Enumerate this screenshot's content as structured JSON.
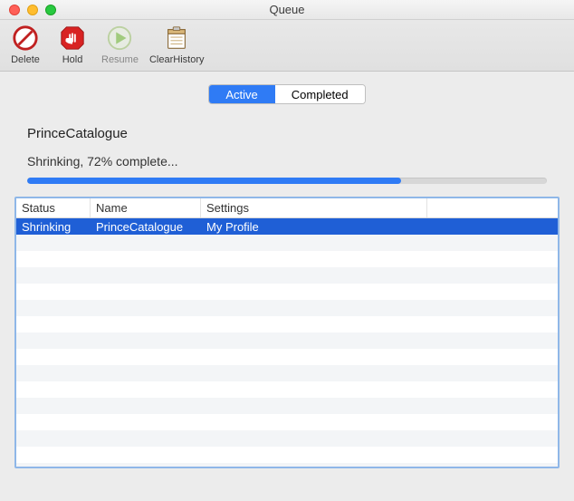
{
  "window": {
    "title": "Queue"
  },
  "toolbar": {
    "delete_label": "Delete",
    "hold_label": "Hold",
    "resume_label": "Resume",
    "clear_history_label": "ClearHistory"
  },
  "tabs": {
    "active_label": "Active",
    "completed_label": "Completed"
  },
  "job": {
    "name": "PrinceCatalogue",
    "status_text": "Shrinking, 72% complete...",
    "progress_percent": 72
  },
  "table": {
    "columns": {
      "status": "Status",
      "name": "Name",
      "settings": "Settings"
    },
    "rows": [
      {
        "status": "Shrinking",
        "name": "PrinceCatalogue",
        "settings": "My Profile"
      }
    ]
  }
}
